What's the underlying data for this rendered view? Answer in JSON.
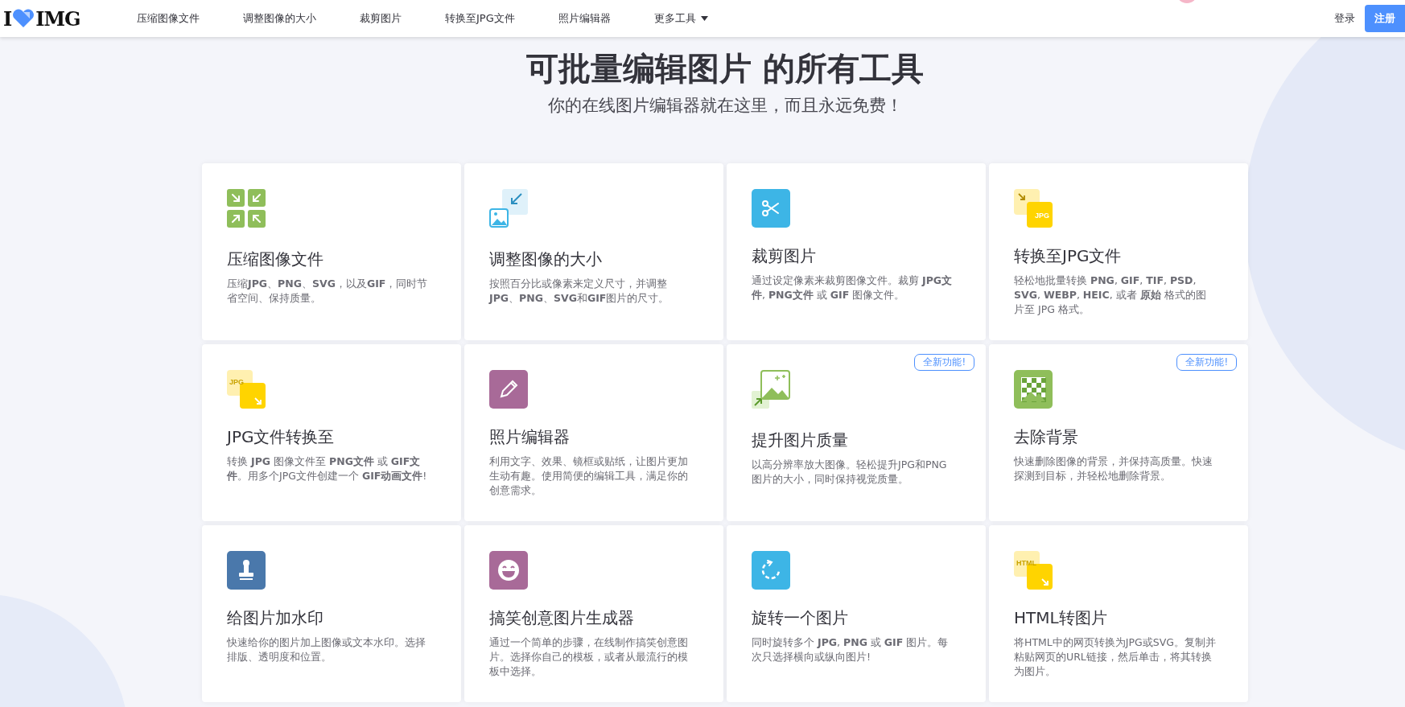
{
  "header": {
    "logo": {
      "left": "I",
      "right": "IMG"
    },
    "nav": [
      {
        "label": "压缩图像文件",
        "dropdown": false
      },
      {
        "label": "调整图像的大小",
        "dropdown": false
      },
      {
        "label": "裁剪图片",
        "dropdown": false
      },
      {
        "label": "转换至JPG文件",
        "dropdown": false
      },
      {
        "label": "照片编辑器",
        "dropdown": false
      },
      {
        "label": "更多工具",
        "dropdown": true
      }
    ],
    "login": "登录",
    "signup": "注册"
  },
  "hero": {
    "title": "可批量编辑图片 的所有工具",
    "subtitle": "你的在线图片编辑器就在这里，而且永远免费！"
  },
  "tools": [
    {
      "kind": "compress",
      "title": "压缩图像文件",
      "description": "压缩**JPG**、**PNG**、**SVG**，以及**GIF**，同时节省空间、保持质量。"
    },
    {
      "kind": "resize",
      "title": "调整图像的大小",
      "description": "按照百分比或像素来定义尺寸，并调整**JPG**、**PNG**、**SVG**和**GIF**图片的尺寸。"
    },
    {
      "kind": "crop",
      "title": "裁剪图片",
      "description": "通过设定像素来裁剪图像文件。裁剪 **JPG文件**, **PNG文件** 或 **GIF** 图像文件。"
    },
    {
      "kind": "to_format",
      "icon_label": "JPG",
      "title": "转换至JPG文件",
      "description": "轻松地批量转换 **PNG**, **GIF**, **TIF**, **PSD**, **SVG**, **WEBP**, **HEIC**, 或者 **原始** 格式的图片至 JPG 格式。"
    },
    {
      "kind": "from_format",
      "icon_label": "JPG",
      "title": "JPG文件转换至",
      "description": "转换 **JPG** 图像文件至 **PNG文件** 或 **GIF文件**。用多个JPG文件创建一个 **GIF动画文件**!"
    },
    {
      "kind": "editor",
      "title": "照片编辑器",
      "description": "利用文字、效果、镜框或贴纸，让图片更加生动有趣。使用简便的编辑工具，满足你的创意需求。"
    },
    {
      "kind": "upscale",
      "badge": "全新功能!",
      "title": "提升图片质量",
      "description": "以高分辨率放大图像。轻松提升JPG和PNG图片的大小，同时保持视觉质量。"
    },
    {
      "kind": "remove_bg",
      "badge": "全新功能!",
      "title": "去除背景",
      "description": "快速删除图像的背景，并保持高质量。快速探测到目标，并轻松地删除背景。"
    },
    {
      "kind": "watermark",
      "title": "给图片加水印",
      "description": "快速给你的图片加上图像或文本水印。选择排版、透明度和位置。"
    },
    {
      "kind": "meme",
      "title": "搞笑创意图片生成器",
      "description": "通过一个简单的步骤，在线制作搞笑创意图片。选择你自己的模板，或者从最流行的模板中选择。"
    },
    {
      "kind": "rotate",
      "title": "旋转一个图片",
      "description": "同时旋转多个 **JPG**, **PNG** 或 **GIF** 图片。每次只选择横向或纵向图片!"
    },
    {
      "kind": "from_format",
      "icon_label": "HTML",
      "title": "HTML转图片",
      "description": "将HTML中的网页转换为JPG或SVG。复制并粘贴网页的URL链接，然后单击，将其转换为图片。"
    }
  ]
}
